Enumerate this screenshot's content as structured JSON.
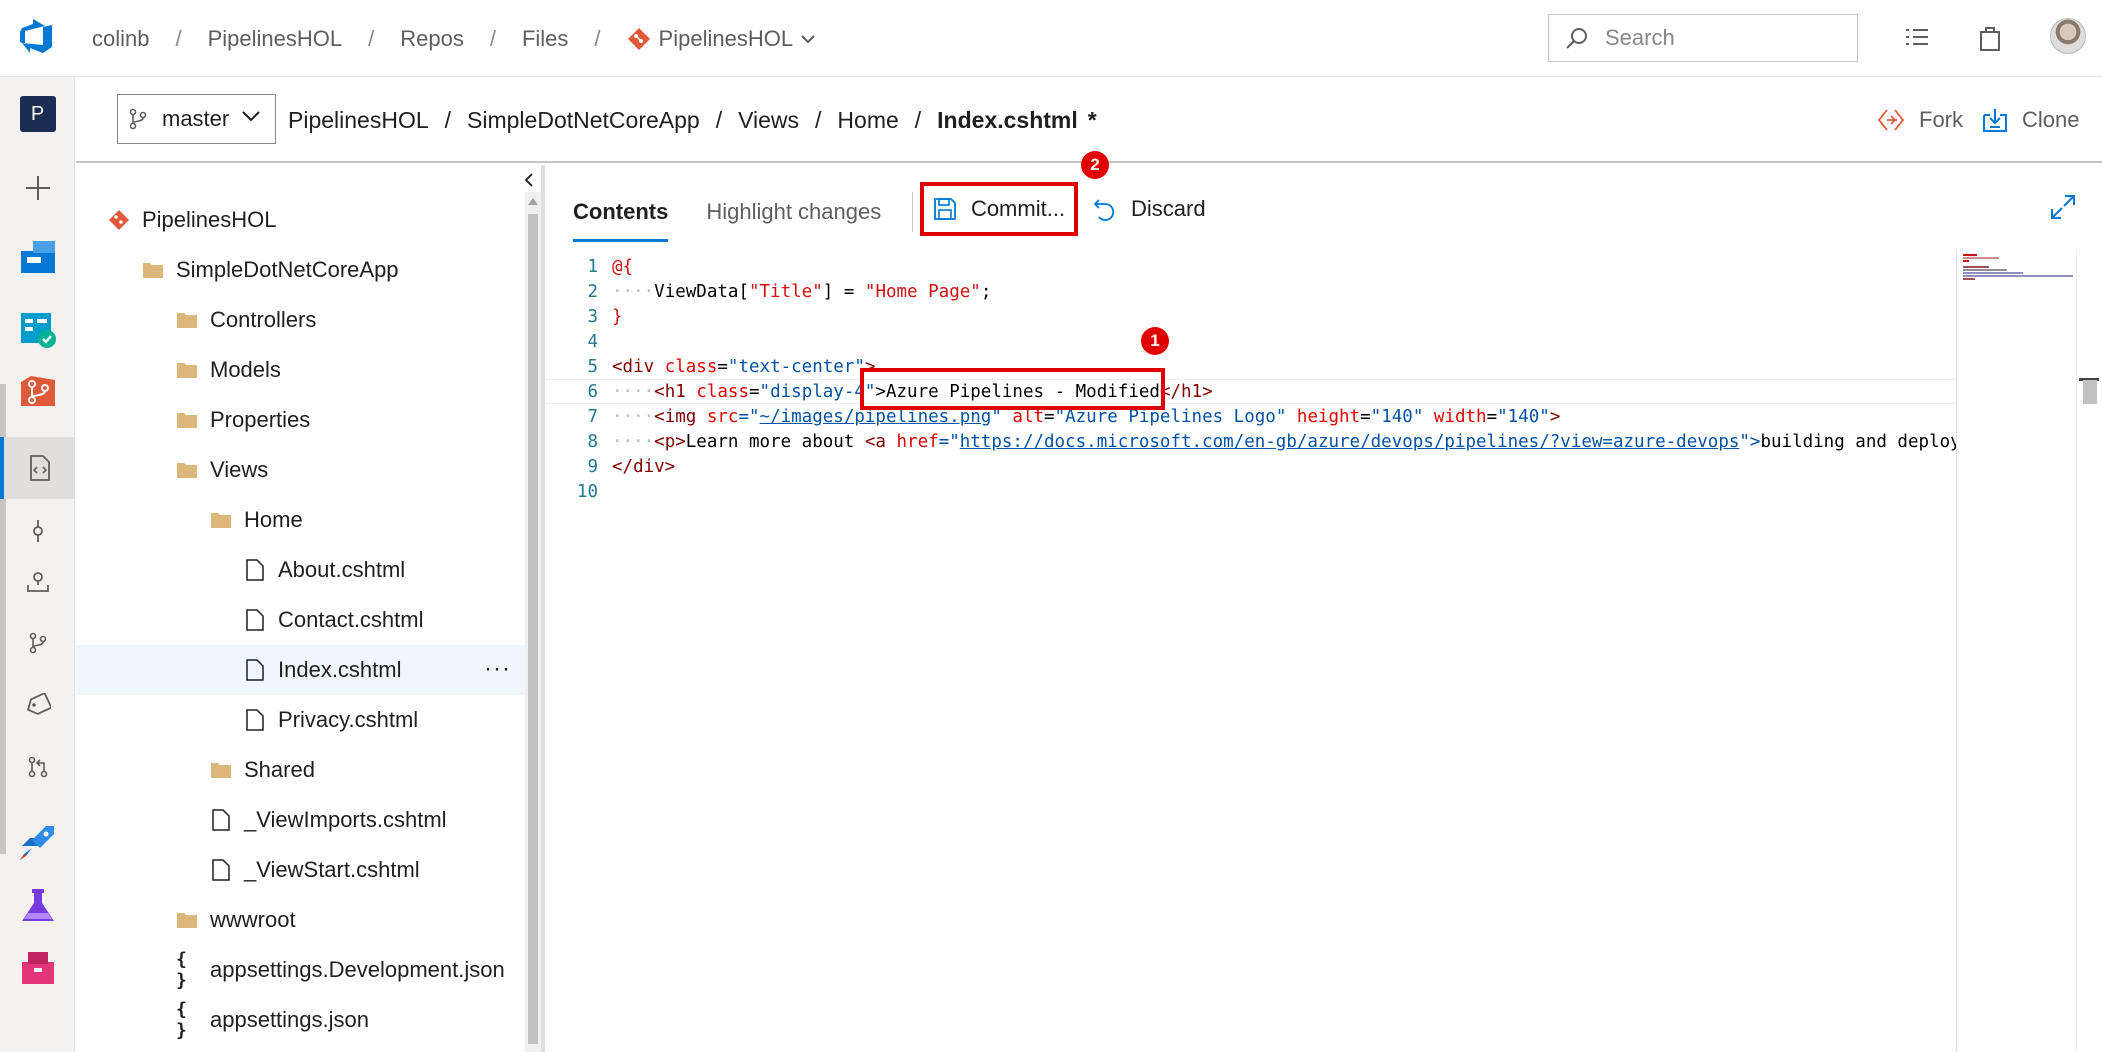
{
  "colors": {
    "accent": "#0078d4",
    "callout": "#e00000",
    "git": "#e05a3a"
  },
  "topbar": {
    "breadcrumbs": [
      "colinb",
      "PipelinesHOL",
      "Repos",
      "Files"
    ],
    "repo": "PipelinesHOL",
    "search_placeholder": "Search"
  },
  "rail": {
    "project_initial": "P"
  },
  "pathbar": {
    "branch": "master",
    "path": [
      "PipelinesHOL",
      "SimpleDotNetCoreApp",
      "Views",
      "Home"
    ],
    "file": "Index.cshtml",
    "dirty_marker": "*",
    "fork": "Fork",
    "clone": "Clone"
  },
  "tree": {
    "repo_root": "PipelinesHOL",
    "items": [
      {
        "label": "SimpleDotNetCoreApp",
        "icon": "folder-icon"
      },
      {
        "label": "Controllers",
        "icon": "folder-icon"
      },
      {
        "label": "Models",
        "icon": "folder-icon"
      },
      {
        "label": "Properties",
        "icon": "folder-icon"
      },
      {
        "label": "Views",
        "icon": "folder-icon"
      },
      {
        "label": "Home",
        "icon": "folder-icon"
      },
      {
        "label": "About.cshtml",
        "icon": "file-icon"
      },
      {
        "label": "Contact.cshtml",
        "icon": "file-icon"
      },
      {
        "label": "Index.cshtml",
        "icon": "file-icon",
        "selected": true
      },
      {
        "label": "Privacy.cshtml",
        "icon": "file-icon"
      },
      {
        "label": "Shared",
        "icon": "folder-icon"
      },
      {
        "label": "_ViewImports.cshtml",
        "icon": "file-icon"
      },
      {
        "label": "_ViewStart.cshtml",
        "icon": "file-icon"
      },
      {
        "label": "wwwroot",
        "icon": "folder-icon"
      },
      {
        "label": "appsettings.Development.json",
        "icon": "json-icon"
      },
      {
        "label": "appsettings.json",
        "icon": "json-icon"
      }
    ],
    "more_menu": "···"
  },
  "editor": {
    "tabs": [
      "Contents",
      "Highlight changes"
    ],
    "commit": "Commit...",
    "discard": "Discard",
    "callouts": [
      "1",
      "2"
    ],
    "line_numbers": [
      "1",
      "2",
      "3",
      "4",
      "5",
      "6",
      "7",
      "8",
      "9",
      "10"
    ],
    "code": {
      "l1": "@{",
      "l2_a": "ViewData[",
      "l2_b": "\"Title\"",
      "l2_c": "] = ",
      "l2_d": "\"Home Page\"",
      "l2_e": ";",
      "l3": "}",
      "l5_a": "<div ",
      "l5_b": "class",
      "l5_c": "=",
      "l5_d": "\"text-center\"",
      "l5_e": ">",
      "l6_a": "<h1 ",
      "l6_b": "class",
      "l6_c": "=",
      "l6_d": "\"display-4\"",
      "l6_e": ">Azure Pipelines - Modified",
      "l6_f": "</h1>",
      "l7_a": "<img ",
      "l7_b": "src",
      "l7_c": "=\"",
      "l7_d": "~/images/pipelines.png",
      "l7_e": "\" ",
      "l7_f": "alt",
      "l7_g": "=",
      "l7_h": "\"Azure Pipelines Logo\"",
      "l7_i": " ",
      "l7_j": "height",
      "l7_k": "=",
      "l7_l": "\"140\"",
      "l7_m": " ",
      "l7_n": "width",
      "l7_o": "=",
      "l7_p": "\"140\"",
      "l7_q": ">",
      "l8_a": "<p>",
      "l8_b": "Learn more about ",
      "l8_c": "<a ",
      "l8_d": "href",
      "l8_e": "=\"",
      "l8_f": "https://docs.microsoft.com/en-gb/azure/devops/pipelines/?view=azure-devops",
      "l8_g": "\">",
      "l8_h": "building and deploying",
      "l9": "</div>"
    }
  }
}
